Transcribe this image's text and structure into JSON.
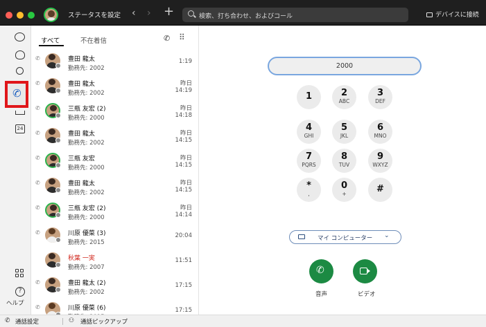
{
  "titlebar": {
    "status_label": "ステータスを設定",
    "back_glyph": "‹",
    "forward_glyph": "›",
    "new_glyph": "+",
    "search_placeholder": "検索、打ち合わせ、およびコール",
    "device_label": "デバイスに接続"
  },
  "rail": {
    "items": [
      "chat-icon",
      "teams-icon",
      "search-icon",
      "calling-icon",
      "contacts-icon",
      "calendar-icon"
    ],
    "calendar_day": "24",
    "help_glyph": "?",
    "help_label": "ヘルプ",
    "selected": "calling-icon",
    "highlight_color": "#e0161a"
  },
  "calls": {
    "tabs": {
      "all": "すべて",
      "missed": "不在着信"
    },
    "dial_glyph": "✆",
    "grid_glyph": "⠿",
    "rows": [
      {
        "name": "豊田 龍太",
        "sub": "勤務先: 2002",
        "t1": "1:19",
        "t2": ""
      },
      {
        "name": "豊田 龍太",
        "sub": "勤務先: 2002",
        "t1": "昨日",
        "t2": "14:19"
      },
      {
        "name": "三瓶 友宏 (2)",
        "sub": "勤務先: 2000",
        "t1": "昨日",
        "t2": "14:18"
      },
      {
        "name": "豊田 龍太",
        "sub": "勤務先: 2002",
        "t1": "昨日",
        "t2": "14:15"
      },
      {
        "name": "三瓶 友宏",
        "sub": "勤務先: 2000",
        "t1": "昨日",
        "t2": "14:15"
      },
      {
        "name": "豊田 龍太",
        "sub": "勤務先: 2002",
        "t1": "昨日",
        "t2": "14:15"
      },
      {
        "name": "三瓶 友宏 (2)",
        "sub": "勤務先: 2000",
        "t1": "昨日",
        "t2": "14:14"
      },
      {
        "name": "川原 優菜 (3)",
        "sub": "勤務先: 2015",
        "t1": "20:04",
        "t2": ""
      },
      {
        "name": "秋葉 一実",
        "sub": "勤務先: 2007",
        "t1": "11:51",
        "t2": ""
      },
      {
        "name": "豊田 龍太 (2)",
        "sub": "勤務先: 2002",
        "t1": "17:15",
        "t2": ""
      },
      {
        "name": "川原 優菜 (6)",
        "sub": "勤務先: 2015",
        "t1": "17:15",
        "t2": ""
      }
    ],
    "missed_color": "#d0271d"
  },
  "dialpad": {
    "number_value": "2000",
    "keys": [
      {
        "d": "1",
        "l": ""
      },
      {
        "d": "2",
        "l": "ABC"
      },
      {
        "d": "3",
        "l": "DEF"
      },
      {
        "d": "4",
        "l": "GHI"
      },
      {
        "d": "5",
        "l": "JKL"
      },
      {
        "d": "6",
        "l": "MNO"
      },
      {
        "d": "7",
        "l": "PQRS"
      },
      {
        "d": "8",
        "l": "TUV"
      },
      {
        "d": "9",
        "l": "WXYZ"
      },
      {
        "d": "*",
        "l": ","
      },
      {
        "d": "0",
        "l": "+"
      },
      {
        "d": "#",
        "l": ""
      }
    ],
    "audio_source": "マイ コンピューター",
    "audio_label": "音声",
    "video_label": "ビデオ",
    "call_button_color": "#1c8a43"
  },
  "bottombar": {
    "settings_label": "通話設定",
    "pickup_label": "通話ピックアップ"
  }
}
